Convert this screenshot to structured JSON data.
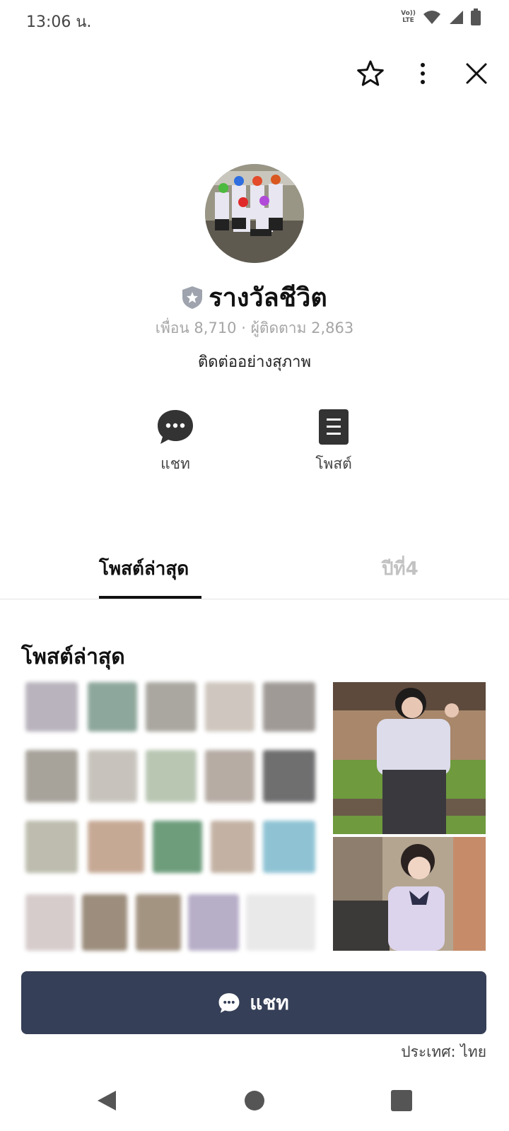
{
  "status_bar": {
    "time": "13:06 น.",
    "volte_top": "Vo))",
    "volte_bottom": "LTE"
  },
  "profile": {
    "name": "รางวัลชีวิต",
    "stats": "เพื่อน 8,710 · ผู้ติดตาม 2,863",
    "status_message": "ติดต่ออย่างสุภาพ"
  },
  "actions": [
    {
      "label": "แชท",
      "icon": "chat-icon"
    },
    {
      "label": "โพสต์",
      "icon": "post-icon"
    }
  ],
  "tabs": [
    {
      "label": "โพสต์ล่าสุด",
      "active": true
    },
    {
      "label": "ปีที่4",
      "active": false
    }
  ],
  "section": {
    "title": "โพสต์ล่าสุด"
  },
  "cta": {
    "label": "แชท"
  },
  "footer": {
    "country": "ประเทศ: ไทย"
  },
  "colors": {
    "cta_bg": "#353f57",
    "tab_active": "#111111",
    "tab_inactive": "#c2c2c2",
    "stats_text": "#a6a6a6"
  }
}
